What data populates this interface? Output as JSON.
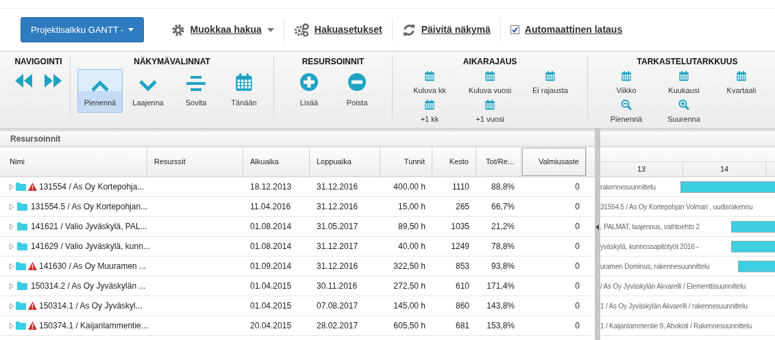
{
  "toolbar": {
    "portfolio_button": "Projektisalkku GANTT -",
    "links": [
      {
        "kind": "gear",
        "label": "Muokkaa hakua",
        "dropdown": true
      },
      {
        "kind": "gears",
        "label": "Hakuasetukset",
        "dropdown": false
      },
      {
        "kind": "refresh",
        "label": "Päivitä näkymä",
        "dropdown": false
      },
      {
        "kind": "checkbox",
        "label": "Automaattinen lataus",
        "checked": true
      }
    ]
  },
  "ribbon": {
    "groups": [
      {
        "title": "NAVIGOINTI",
        "kind": "nav",
        "items": [
          {
            "kind": "rewind"
          },
          {
            "kind": "forward"
          }
        ]
      },
      {
        "title": "NÄKYMÄVALINNAT",
        "kind": "big",
        "items": [
          {
            "kind": "up",
            "label": "Pienennä",
            "selected": true
          },
          {
            "kind": "down",
            "label": "Laajenna",
            "selected": false
          },
          {
            "kind": "align",
            "label": "Sovita",
            "selected": false
          },
          {
            "kind": "calendar",
            "label": "Tänään",
            "selected": false
          }
        ]
      },
      {
        "title": "RESURSOINNIT",
        "kind": "big",
        "items": [
          {
            "kind": "plus",
            "label": "Lisää",
            "selected": false
          },
          {
            "kind": "minus",
            "label": "Poista",
            "selected": false
          }
        ]
      },
      {
        "title": "AIKARAJAUS",
        "kind": "small",
        "items": [
          {
            "kind": "calendar",
            "label": "Kuluva kk"
          },
          {
            "kind": "calendar",
            "label": "Kuluva vuosi"
          },
          {
            "kind": "calendar",
            "label": "Ei rajausta"
          },
          {
            "kind": "calendar",
            "label": "+1 kk"
          },
          {
            "kind": "calendar",
            "label": "+1 vuosi"
          }
        ]
      },
      {
        "title": "TARKASTELUTARKKUUS",
        "kind": "small",
        "items": [
          {
            "kind": "calendar",
            "label": "Viikko"
          },
          {
            "kind": "calendar",
            "label": "Kuukausi"
          },
          {
            "kind": "calendar",
            "label": "Kvartaali"
          },
          {
            "kind": "zoomout",
            "label": "Pienennä"
          },
          {
            "kind": "zoomin",
            "label": "Suurenna"
          }
        ]
      }
    ]
  },
  "grid": {
    "title": "Resursoinnit",
    "columns": [
      {
        "label": "Nimi",
        "focused": false
      },
      {
        "label": "Resurssit",
        "focused": false
      },
      {
        "label": "Alkuaika",
        "focused": false
      },
      {
        "label": "Loppuaika",
        "focused": false
      },
      {
        "label": "Tunnit",
        "focused": false
      },
      {
        "label": "Kesto",
        "focused": false
      },
      {
        "label": "Tot/Re...",
        "focused": false
      },
      {
        "label": "Valmiusaste",
        "focused": true
      }
    ],
    "rows": [
      {
        "warning": true,
        "cells": [
          "131554 / As Oy Kortepohja...",
          "",
          "18.12.2013",
          "31.12.2016",
          "400,00 h",
          "1110",
          "88,8%",
          "0"
        ]
      },
      {
        "warning": false,
        "cells": [
          "131554.5 / As Oy Kortepohjan...",
          "",
          "11.04.2016",
          "31.12.2016",
          "15,00 h",
          "265",
          "66,7%",
          "0"
        ]
      },
      {
        "warning": false,
        "cells": [
          "141621 / Valio Jyväskylä, PAL...",
          "",
          "01.08.2014",
          "31.05.2017",
          "89,50 h",
          "1035",
          "21,2%",
          "0"
        ]
      },
      {
        "warning": false,
        "cells": [
          "141629 / Valio Jyväskylä, kunn...",
          "",
          "01.08.2014",
          "31.12.2017",
          "40,00 h",
          "1249",
          "78,8%",
          "0"
        ]
      },
      {
        "warning": true,
        "cells": [
          "141630 / As Oy Muuramen ...",
          "",
          "01.09.2014",
          "31.12.2016",
          "322,50 h",
          "853",
          "93,8%",
          "0"
        ]
      },
      {
        "warning": false,
        "cells": [
          "150314.2 / As Oy Jyväskylän ...",
          "",
          "01.04.2015",
          "30.11.2016",
          "272,50 h",
          "610",
          "171,4%",
          "0"
        ]
      },
      {
        "warning": true,
        "cells": [
          "150314.1 / As Oy Jyväskyl...",
          "",
          "01.04.2015",
          "07.08.2017",
          "145,00 h",
          "860",
          "143,8%",
          "0"
        ]
      },
      {
        "warning": true,
        "cells": [
          "150374.1 / Kaijanlammentie...",
          "",
          "20.04.2015",
          "28.02.2017",
          "605,50 h",
          "681",
          "153,8%",
          "0"
        ]
      }
    ]
  },
  "gantt": {
    "weeks": [
      "13",
      "14"
    ],
    "rows": [
      {
        "label": "rakennesuunnittelu",
        "level": 0.54
      },
      {
        "label": "31554.5 / As Oy Kortepohjan Volmari , uudisrakennu"
      },
      {
        "label": ", PALMAT, laajennus, vaihtoehto 2",
        "level": 0.25
      },
      {
        "label": "yväskylä, kunnossapitotyöt 2016 -",
        "level": 0.25
      },
      {
        "label": "uramen Dominus, rakennesuunnittelu",
        "level": 0.21
      },
      {
        "label": "/ As Oy Jyväskylän Akvarelli / Elementtisuunnittelu"
      },
      {
        "label": "1 / As Oy Jyväskylän Akvarelli / rakennesuunnittelu"
      },
      {
        "label": "1 / Kaijanlammentie 9, Ahokoti / Rakennesuunnittelu"
      }
    ]
  }
}
